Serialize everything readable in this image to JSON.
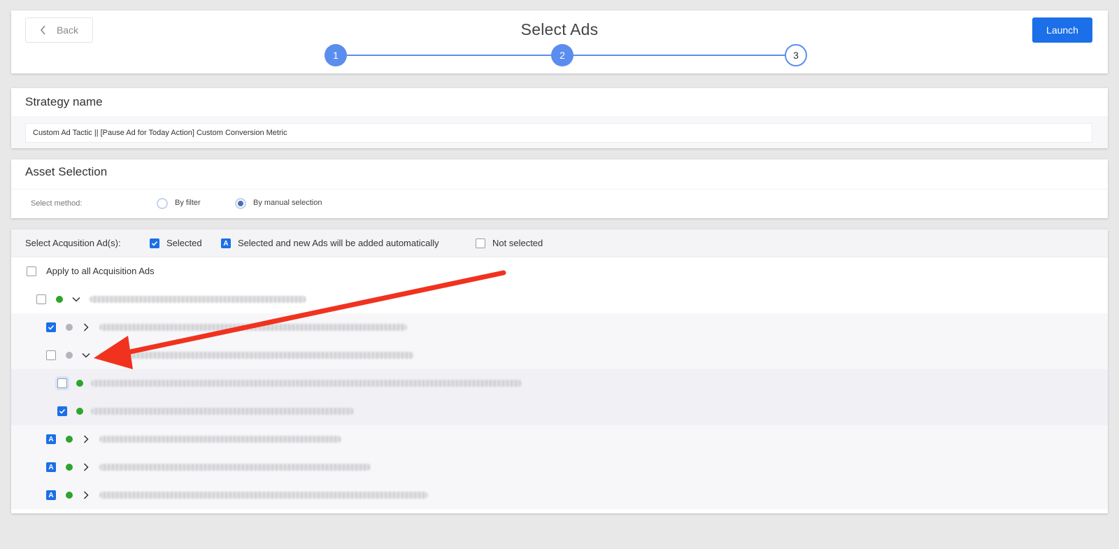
{
  "header": {
    "back_label": "Back",
    "title": "Select Ads",
    "launch_label": "Launch",
    "steps": [
      "1",
      "2",
      "3"
    ]
  },
  "strategy": {
    "title": "Strategy name",
    "value": "Custom Ad Tactic || [Pause Ad for Today Action] Custom Conversion Metric"
  },
  "asset_selection": {
    "title": "Asset Selection",
    "method_label": "Select method:",
    "options": [
      {
        "label": "By filter",
        "selected": false
      },
      {
        "label": "By manual selection",
        "selected": true
      }
    ]
  },
  "ad_selection": {
    "label": "Select Acqusition Ad(s):",
    "legend": [
      {
        "label": "Selected",
        "state": "checked"
      },
      {
        "label": "Selected and new Ads will be added automatically",
        "state": "auto",
        "glyph": "A"
      },
      {
        "label": "Not selected",
        "state": "empty"
      }
    ],
    "apply_all_label": "Apply to all Acquisition Ads",
    "rows": [
      {
        "level": 0,
        "state": "empty",
        "status": "green",
        "expanded": true,
        "name_redacted": true
      },
      {
        "level": 1,
        "state": "checked",
        "status": "gray",
        "expanded": false,
        "name_redacted": true
      },
      {
        "level": 1,
        "state": "empty",
        "status": "gray",
        "expanded": true,
        "name_redacted": true
      },
      {
        "level": 2,
        "state": "focus",
        "status": "green",
        "name_redacted": true
      },
      {
        "level": 2,
        "state": "checked",
        "status": "green",
        "name_redacted": true
      },
      {
        "level": 1,
        "state": "auto",
        "status": "green",
        "expanded": false,
        "name_redacted": true
      },
      {
        "level": 1,
        "state": "auto",
        "status": "green",
        "expanded": false,
        "name_redacted": true
      },
      {
        "level": 1,
        "state": "auto",
        "status": "green",
        "expanded": false,
        "name_redacted": true
      }
    ]
  },
  "colors": {
    "primary": "#1b6fe8",
    "step": "#5b8def",
    "status_green": "#2ca52c",
    "status_gray": "#b4b4bc",
    "annotation_arrow": "#f0321e"
  },
  "icons": [
    "chevron-left-icon",
    "check-icon",
    "chevron-down-icon",
    "chevron-right-icon",
    "annotation-arrow"
  ]
}
